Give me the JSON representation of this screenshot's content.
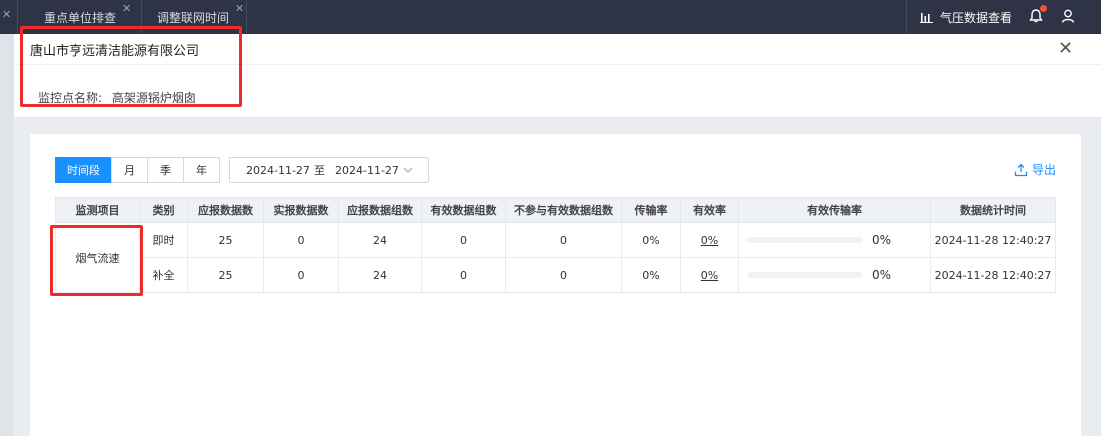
{
  "topbar": {
    "tabs": [
      {
        "label": "重点单位排查",
        "closable": true
      },
      {
        "label": "调整联网时间",
        "closable": true
      }
    ],
    "pressure_label": "气压数据查看"
  },
  "header": {
    "company": "唐山市亨远清洁能源有限公司",
    "monitor_label": "监控点名称:",
    "monitor_value": "高架源锅炉烟囱"
  },
  "toolbar": {
    "periods": [
      "时间段",
      "月",
      "季",
      "年"
    ],
    "active_period": "时间段",
    "date_start": "2024-11-27",
    "date_sep": "至",
    "date_end": "2024-11-27",
    "export_label": "导出"
  },
  "table": {
    "headers": [
      "监测项目",
      "类别",
      "应报数据数",
      "实报数据数",
      "应报数据组数",
      "有效数据组数",
      "不参与有效数据组数",
      "传输率",
      "有效率",
      "有效传输率",
      "数据统计时间"
    ],
    "item": "烟气流速",
    "rows": [
      {
        "category": "即时",
        "expected": "25",
        "reported": "0",
        "expected_groups": "24",
        "valid_groups": "0",
        "excluded_groups": "0",
        "transmission_rate": "0%",
        "valid_rate": "0%",
        "valid_transmission_rate": "0%",
        "valid_transmission_value": 0,
        "stat_time": "2024-11-28 12:40:27"
      },
      {
        "category": "补全",
        "expected": "25",
        "reported": "0",
        "expected_groups": "24",
        "valid_groups": "0",
        "excluded_groups": "0",
        "transmission_rate": "0%",
        "valid_rate": "0%",
        "valid_transmission_rate": "0%",
        "valid_transmission_value": 0,
        "stat_time": "2024-11-28 12:40:27"
      }
    ]
  },
  "colors": {
    "topbar": "#2e3346",
    "accent": "#1890ff",
    "highlight": "#ee2b2b"
  }
}
